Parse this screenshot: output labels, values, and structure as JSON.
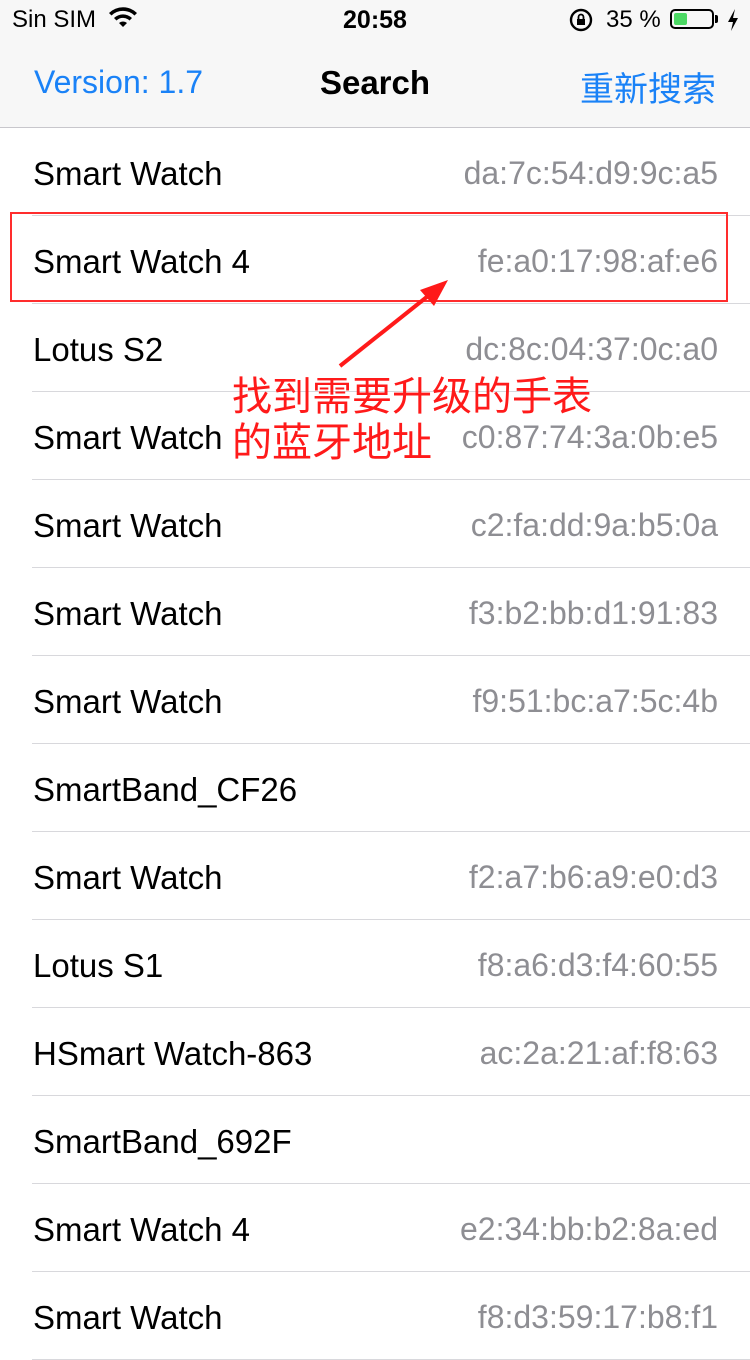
{
  "status_bar": {
    "carrier": "Sin SIM",
    "time": "20:58",
    "battery_percent": "35 %",
    "battery_level": 0.35,
    "icons": [
      "wifi-icon",
      "orientation-lock-icon",
      "battery-icon",
      "charging-bolt-icon"
    ]
  },
  "nav": {
    "version": "Version: 1.7",
    "title": "Search",
    "rescan": "重新搜索"
  },
  "devices": [
    {
      "name": "Smart Watch",
      "mac": "da:7c:54:d9:9c:a5"
    },
    {
      "name": "Smart Watch 4",
      "mac": "fe:a0:17:98:af:e6"
    },
    {
      "name": "Lotus S2",
      "mac": "dc:8c:04:37:0c:a0"
    },
    {
      "name": "Smart Watch",
      "mac": "c0:87:74:3a:0b:e5"
    },
    {
      "name": "Smart Watch",
      "mac": "c2:fa:dd:9a:b5:0a"
    },
    {
      "name": "Smart Watch",
      "mac": "f3:b2:bb:d1:91:83"
    },
    {
      "name": "Smart Watch",
      "mac": "f9:51:bc:a7:5c:4b"
    },
    {
      "name": "SmartBand_CF26",
      "mac": ""
    },
    {
      "name": "Smart Watch",
      "mac": "f2:a7:b6:a9:e0:d3"
    },
    {
      "name": "Lotus S1",
      "mac": "f8:a6:d3:f4:60:55"
    },
    {
      "name": "HSmart Watch-863",
      "mac": "ac:2a:21:af:f8:63"
    },
    {
      "name": "SmartBand_692F",
      "mac": ""
    },
    {
      "name": "Smart Watch 4",
      "mac": "e2:34:bb:b2:8a:ed"
    },
    {
      "name": "Smart Watch",
      "mac": "f8:d3:59:17:b8:f1"
    }
  ],
  "annotation": {
    "line1": "找到需要升级的手表",
    "line2": "的蓝牙地址",
    "color": "#ff1a1a"
  },
  "colors": {
    "accent": "#1a82f7",
    "mac_text": "#8e8e93",
    "highlight": "#ff2d2d",
    "battery_fill": "#4cd964"
  }
}
